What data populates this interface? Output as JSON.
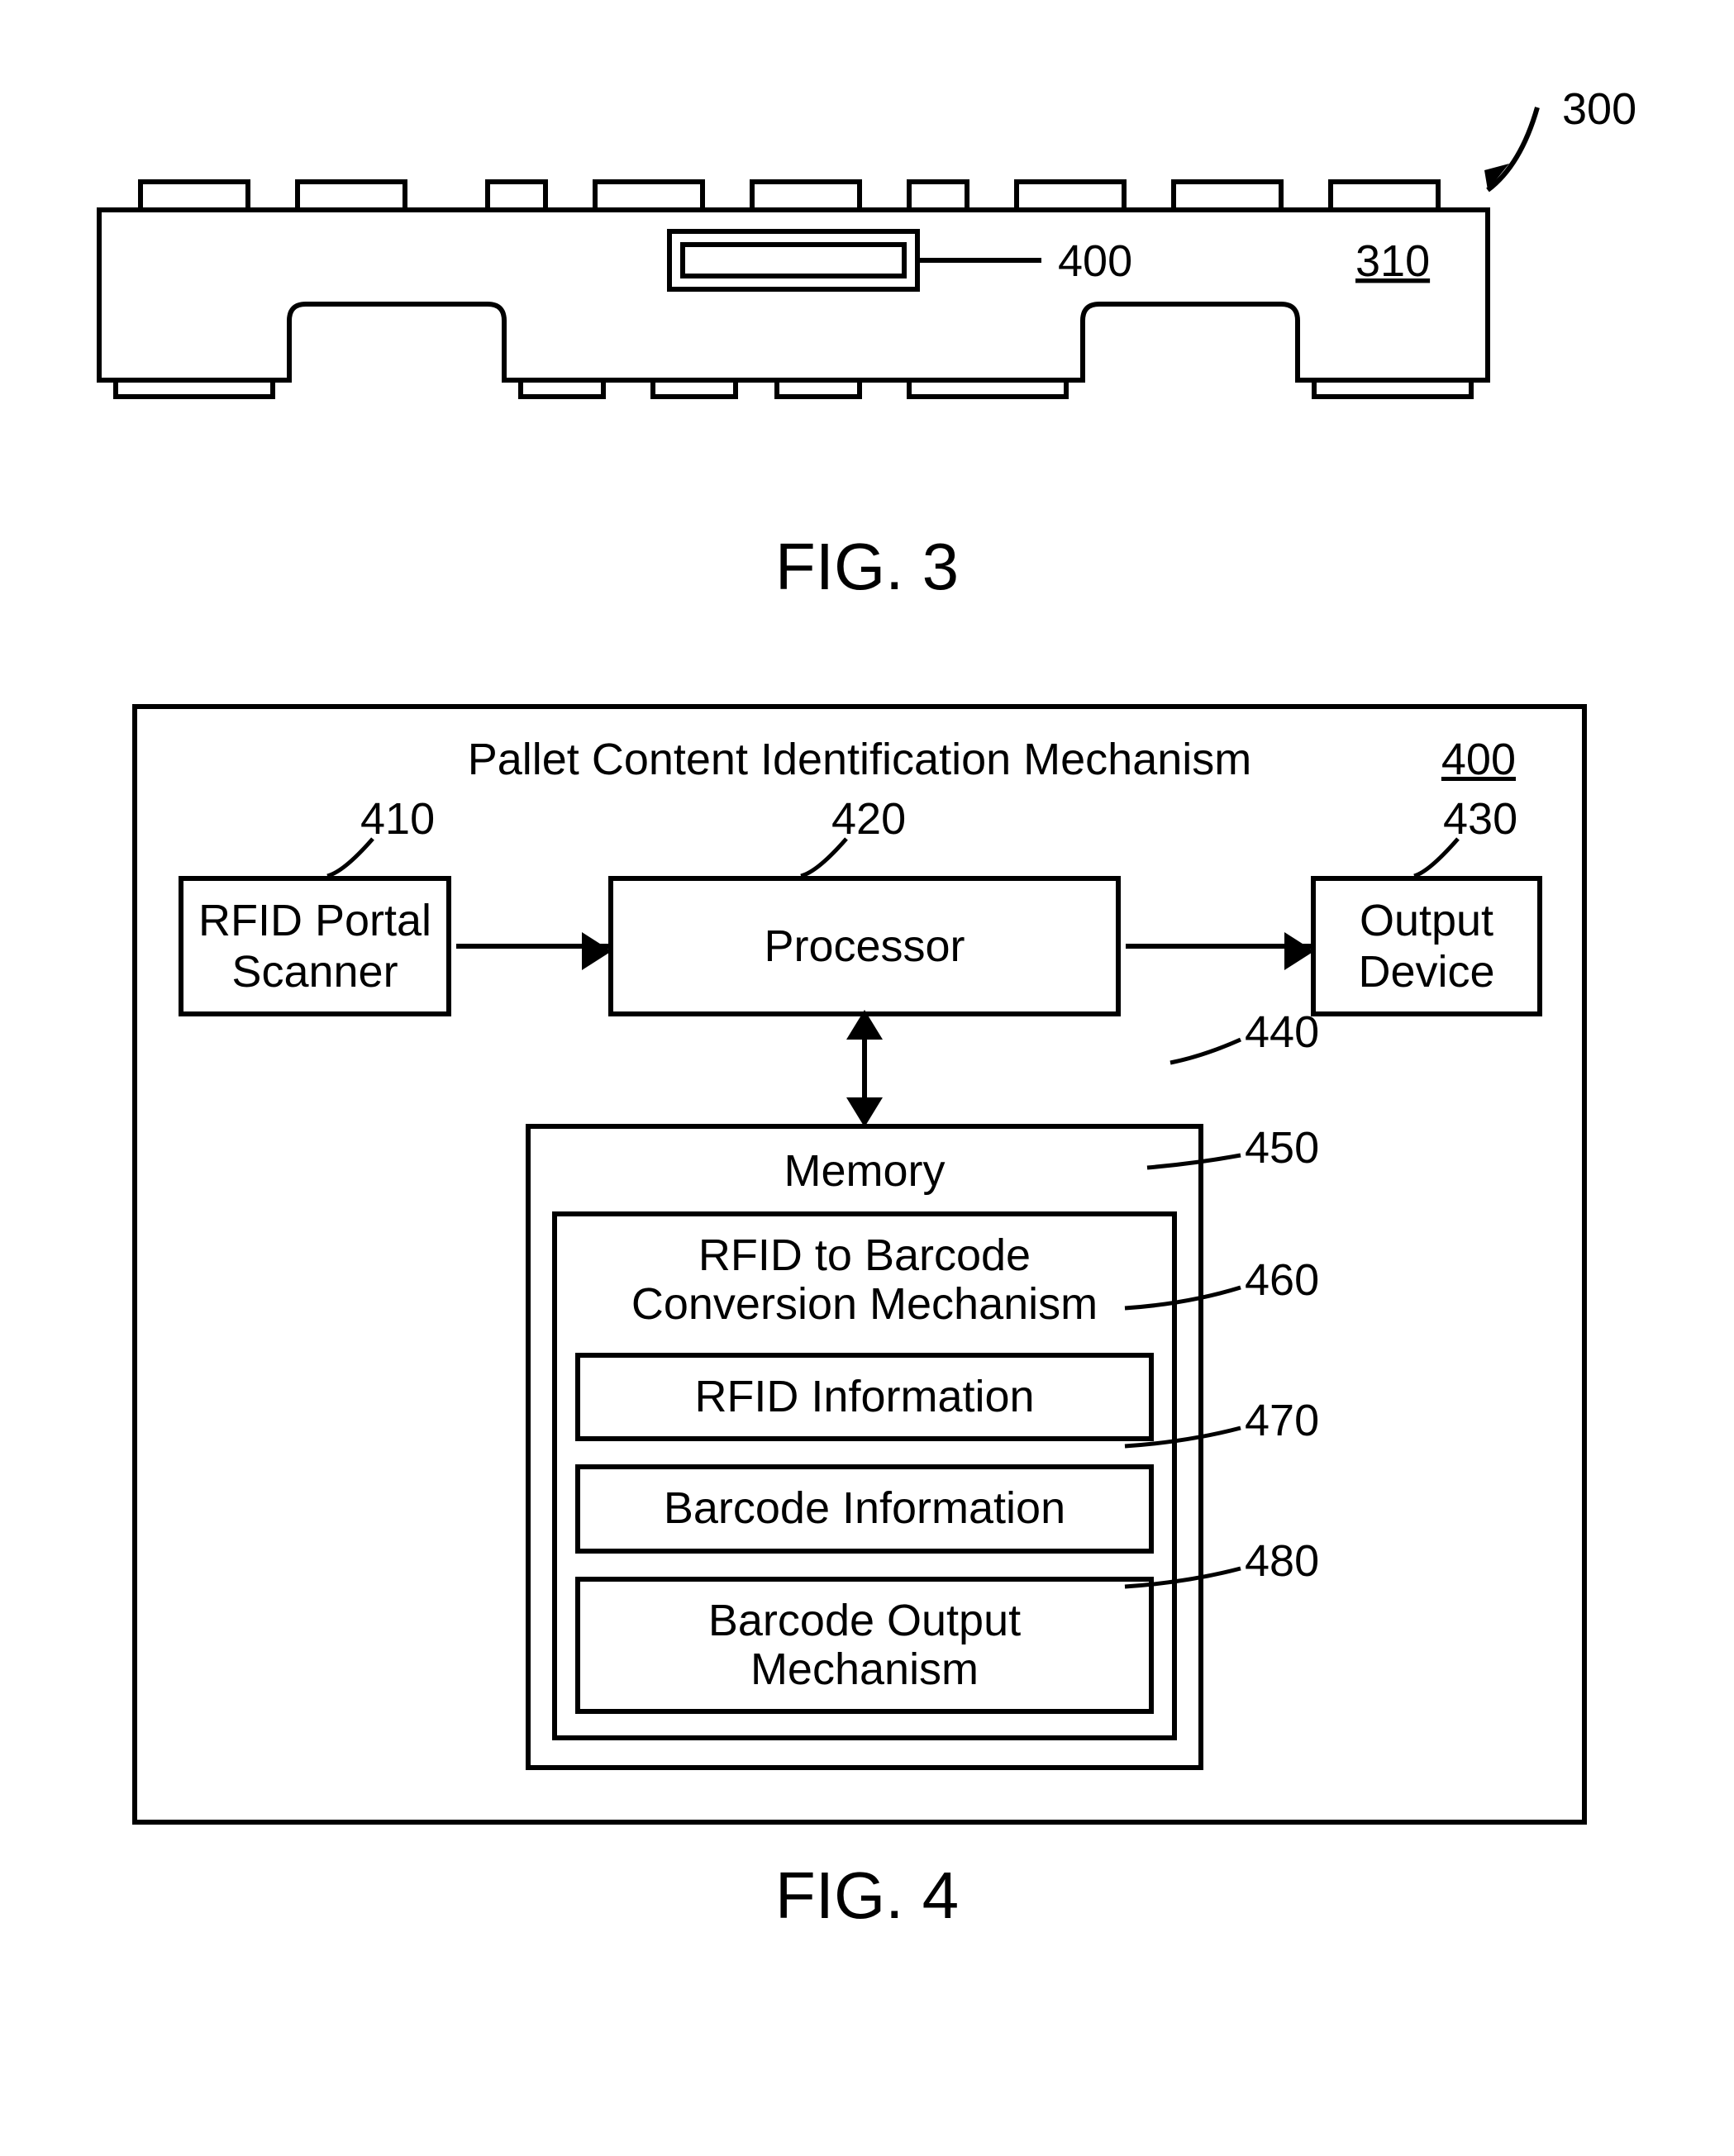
{
  "fig3": {
    "caption": "FIG. 3",
    "ref_pallet": "300",
    "ref_body": "310",
    "ref_device": "400"
  },
  "fig4": {
    "caption": "FIG. 4",
    "title": "Pallet Content Identification Mechanism",
    "title_ref": "400",
    "boxes": {
      "rfid_scanner": "RFID Portal\nScanner",
      "processor": "Processor",
      "output_device": "Output\nDevice",
      "memory": "Memory",
      "conversion": "RFID to Barcode\nConversion Mechanism",
      "rfid_info": "RFID Information",
      "barcode_info": "Barcode Information",
      "barcode_out": "Barcode Output\nMechanism"
    },
    "refs": {
      "r410": "410",
      "r420": "420",
      "r430": "430",
      "r440": "440",
      "r450": "450",
      "r460": "460",
      "r470": "470",
      "r480": "480"
    }
  }
}
